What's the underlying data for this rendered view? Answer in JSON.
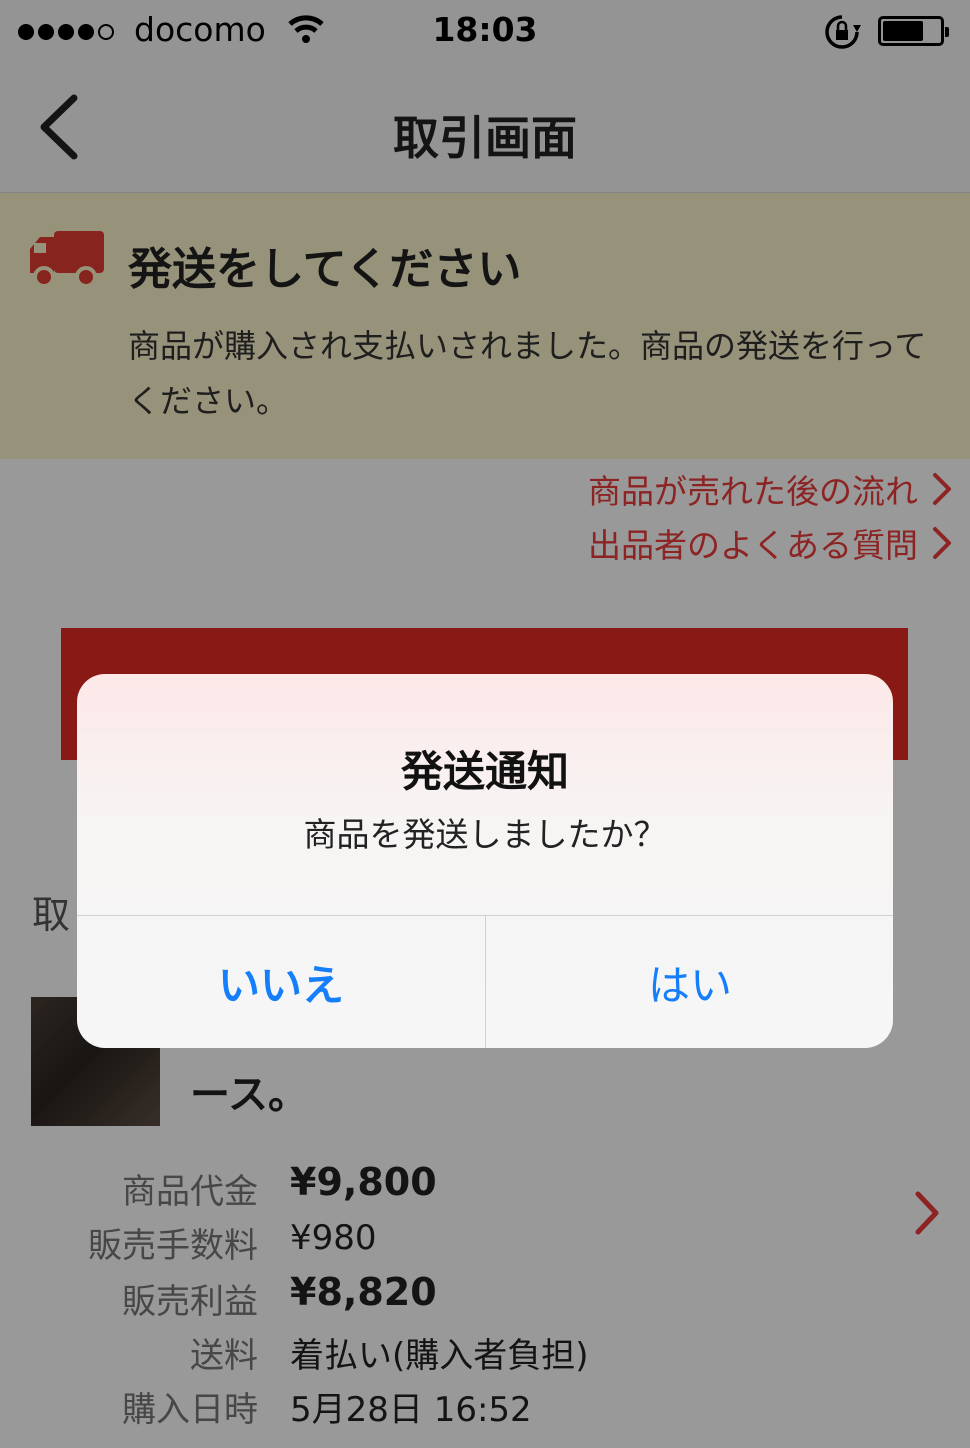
{
  "status_bar": {
    "carrier": "docomo",
    "time": "18:03",
    "signal_bars_filled": 4,
    "signal_bars_total": 5
  },
  "nav": {
    "title": "取引画面"
  },
  "notice": {
    "title": "発送をしてください",
    "body": "商品が購入され支払いされました。商品の発送を行ってください。",
    "accent_color": "#e23c31"
  },
  "links": [
    {
      "label": "商品が売れた後の流れ"
    },
    {
      "label": "出品者のよくある質問"
    }
  ],
  "section": {
    "label": "取"
  },
  "item": {
    "name_fragment": "ース。"
  },
  "prices": [
    {
      "label": "商品代金",
      "value": "¥9,800",
      "emphasis": true
    },
    {
      "label": "販売手数料",
      "value": "¥980",
      "emphasis": false
    },
    {
      "label": "販売利益",
      "value": "¥8,820",
      "emphasis": true
    },
    {
      "label": "送料",
      "value": "着払い(購入者負担)",
      "emphasis": false
    },
    {
      "label": "購入日時",
      "value": "5月28日 16:52",
      "emphasis": false
    }
  ],
  "dialog": {
    "title": "発送通知",
    "message": "商品を発送しましたか？",
    "no_label": "いいえ",
    "yes_label": "はい",
    "button_color": "#147efb"
  }
}
